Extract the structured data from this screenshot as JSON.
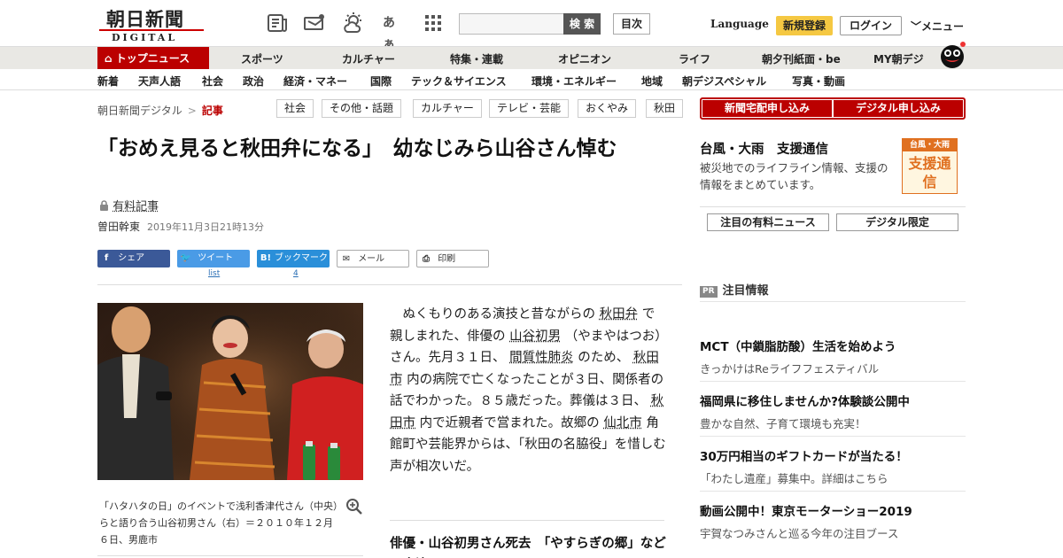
{
  "header": {
    "logo_main": "朝日新聞",
    "logo_sub": "DIGITAL",
    "icons": [
      "newspaper-icon",
      "megaphone-icon",
      "weather-icon",
      "font-size-icon",
      "grid-icon"
    ],
    "font_icon_text": "あぁ",
    "search_placeholder": "",
    "search_label": "検 索",
    "toc_label": "目次",
    "language_label": "Language",
    "signup_label": "新規登録",
    "login_label": "ログイン",
    "menu_label": "メニュー",
    "accent_color": "#b00000",
    "signup_color": "#f5c842"
  },
  "nav_primary": [
    "トップニュース",
    "スポーツ",
    "カルチャー",
    "特集・連載",
    "オピニオン",
    "ライフ",
    "朝夕刊紙面・be",
    "MY朝デジ"
  ],
  "nav_secondary": [
    "新着",
    "天声人語",
    "社会",
    "政治",
    "経済・マネー",
    "国際",
    "テック＆サイエンス",
    "環境・エネルギー",
    "地域",
    "朝デジスペシャル",
    "写真・動画"
  ],
  "breadcrumb": {
    "home": "朝日新聞デジタル",
    "separator": ">",
    "current": "記事"
  },
  "tags": [
    "社会",
    "その他・話題",
    "カルチャー",
    "テレビ・芸能",
    "おくやみ",
    "秋田"
  ],
  "article": {
    "headline": "「おめえ見ると秋田弁になる」　幼なじみら山谷さん悼む",
    "paid_label": "有料記事",
    "author": "曽田幹東",
    "date": "2019年11月3日21時13分",
    "share": {
      "facebook": "シェア",
      "twitter": "ツイート",
      "hatena": "ブックマーク",
      "mail": "メール",
      "print": "印刷",
      "twitter_count": "list",
      "hatena_count": "4"
    },
    "photo_caption": "「ハタハタの日」のイベントで浅利香津代さん（中央）らと語り合う山谷初男さん（右）＝２０１０年１２月６日、男鹿市",
    "body": [
      "ぬくもりのある演技と昔ながらの ",
      "秋田弁",
      " で親しまれた、俳優の ",
      "山谷初男",
      " （やまやはつお）さん。先月３１日、 ",
      "間質性肺炎",
      " のため、 ",
      "秋田市",
      " 内の病院で亡くなったことが３日、関係者の話でわかった。８５歳だった。葬儀は３日、 ",
      "秋田市",
      " 内で近親者で営まれた。故郷の ",
      "仙北市",
      " 角館町や芸能界からは、「秋田の名脇役」を惜しむ声が相次いだ。"
    ],
    "related_heading": "俳優・山谷初男さん死去　「やすらぎの郷」などに出演"
  },
  "sidebar": {
    "cta_home": "新聞宅配申し込み",
    "cta_digital": "デジタル申し込み",
    "support_title": "台風・大雨　支援通信",
    "support_desc": "被災地でのライフライン情報、支援の情報をまとめています。",
    "support_img_top": "台風・大雨",
    "support_img_main": "支援通信",
    "pill_left": "注目の有料ニュース",
    "pill_right": "デジタル限定",
    "pr_badge": "PR",
    "pr_heading": "注目情報",
    "pr_items": [
      {
        "title": "MCT（中鎖脂肪酸）生活を始めよう",
        "sub": "きっかけはReライフフェスティバル"
      },
      {
        "title": "福岡県に移住しませんか?体験談公開中",
        "sub": "豊かな自然、子育て環境も充実！"
      },
      {
        "title": "30万円相当のギフトカードが当たる！",
        "sub": "「わたし遺産」募集中。詳細はこちら"
      },
      {
        "title": "動画公開中！東京モーターショー2019",
        "sub": "宇賀なつみさんと巡る今年の注目ブース"
      }
    ]
  }
}
